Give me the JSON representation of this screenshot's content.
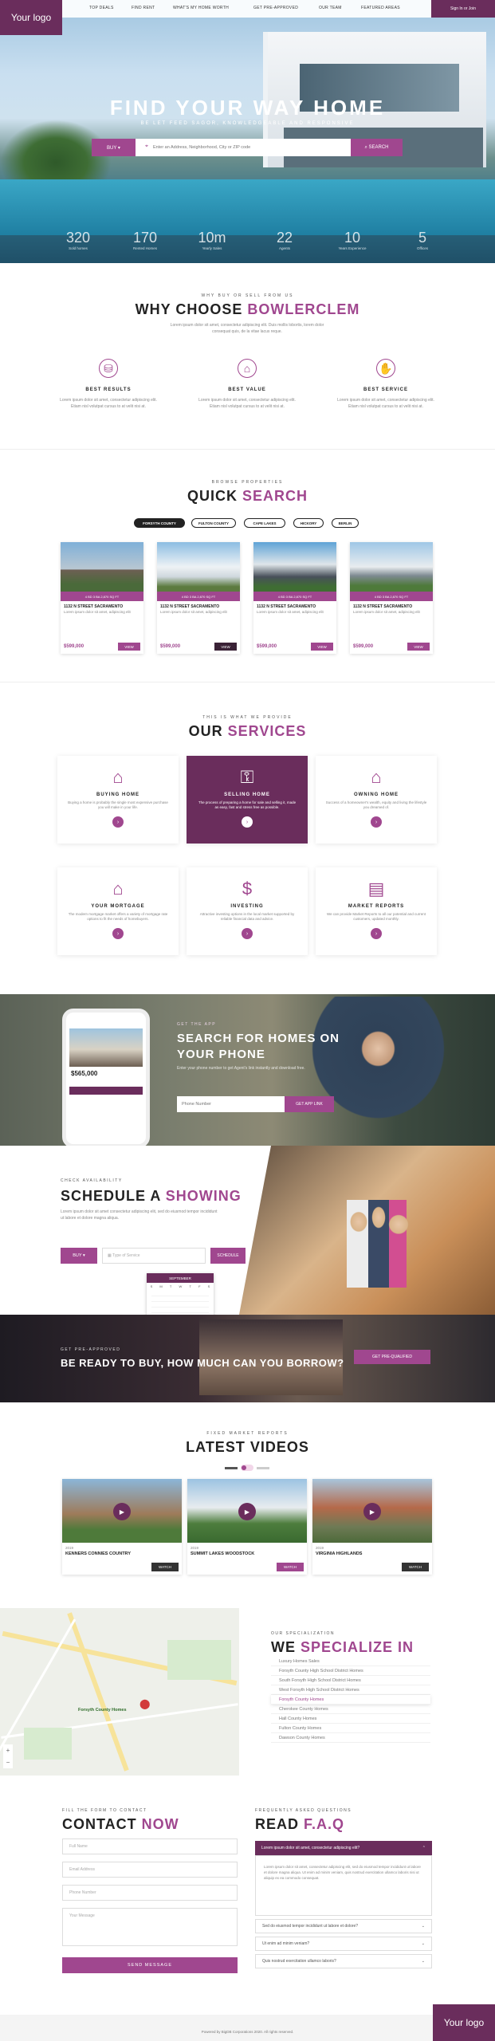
{
  "brand": {
    "logo": "Your logo",
    "accent": "#a0478f",
    "dark": "#6a2d5c"
  },
  "nav": {
    "items": [
      "Top Deals",
      "Find Rent",
      "What's My Home Worth",
      "Get Pre-Approved",
      "Our Team",
      "Featured Areas"
    ],
    "signin": "Sign In or Join"
  },
  "hero": {
    "title": "FIND YOUR WAY HOME",
    "subtitle": "BE LET FEED SAGOR, KNOWLEDGEABLE AND RESPONSIVE",
    "buy": "BUY ▾",
    "placeholder": "Enter an Address, Neighborhood, City or ZIP code",
    "search": "SEARCH",
    "stats": [
      {
        "n": "320",
        "l": "Sold homes"
      },
      {
        "n": "170",
        "l": "Rented Homes"
      },
      {
        "n": "10m",
        "l": "Yearly Sales"
      },
      {
        "n": "22",
        "l": "Agents"
      },
      {
        "n": "10",
        "l": "Years Experience"
      },
      {
        "n": "5",
        "l": "Offices"
      }
    ]
  },
  "why": {
    "kicker": "WHY BUY OR SELL FROM US",
    "title": "WHY CHOOSE",
    "title_acc": "BOWLERCLEM",
    "text": "Lorem ipsum dolor sit amet, consectetur adipiscing elit. Duis mollis lobortis, lorem dolor consequat quis, de la vitae lacus reque.",
    "items": [
      {
        "icon": "handshake-money-icon",
        "t": "BEST RESULTS",
        "d": "Lorem ipsum dolor sit amet, consectetur adipiscing elit. Etiam nisl volutpat cursus to at velit nisi at."
      },
      {
        "icon": "house-heart-icon",
        "t": "BEST VALUE",
        "d": "Lorem ipsum dolor sit amet, consectetur adipiscing elit. Etiam nisl volutpat cursus to at velit nisi at."
      },
      {
        "icon": "handshake-icon",
        "t": "BEST SERVICE",
        "d": "Lorem ipsum dolor sit amet, consectetur adipiscing elit. Etiam nisl volutpat cursus to at velit nisi at."
      }
    ]
  },
  "quick": {
    "kicker": "BROWSE PROPERTIES",
    "title": "QUICK",
    "title_acc": "SEARCH",
    "tabs": [
      "FORSYTH COUNTY",
      "FULTON COUNTY",
      "CAPE LAKES",
      "HICKORY",
      "BERLIN"
    ],
    "cards": [
      {
        "bar": "4 BD   3 BA   2,870 SQ FT",
        "addr": "1132 N STREET SACRAMENTO",
        "desc": "Lorem ipsum dolor sit amet, adipiscing elit",
        "price": "$599,000",
        "view": "VIEW"
      },
      {
        "bar": "4 BD   3 BA   2,870 SQ FT",
        "addr": "1132 N STREET SACRAMENTO",
        "desc": "Lorem ipsum dolor sit amet, adipiscing elit",
        "price": "$599,000",
        "view": "VIEW"
      },
      {
        "bar": "4 BD   3 BA   2,870 SQ FT",
        "addr": "1132 N STREET SACRAMENTO",
        "desc": "Lorem ipsum dolor sit amet, adipiscing elit",
        "price": "$599,000",
        "view": "VIEW"
      },
      {
        "bar": "4 BD   3 BA   2,870 SQ FT",
        "addr": "1132 N STREET SACRAMENTO",
        "desc": "Lorem ipsum dolor sit amet, adipiscing elit",
        "price": "$599,000",
        "view": "VIEW"
      }
    ]
  },
  "services": {
    "kicker": "THIS IS WHAT WE PROVIDE",
    "title": "OUR",
    "title_acc": "SERVICES",
    "items": [
      {
        "icon": "money-house-icon",
        "t": "BUYING HOME",
        "d": "Buying a home is probably the single most expensive purchase you will make in your life."
      },
      {
        "icon": "key-house-icon",
        "t": "SELLING HOME",
        "d": "The process of preparing a home for sale and selling it, made as easy, fast and stress free as possible."
      },
      {
        "icon": "house-hands-icon",
        "t": "OWNING HOME",
        "d": "Success of a homeowner's wealth, equity and living the lifestyle you dreamed of."
      },
      {
        "icon": "mortgage-house-icon",
        "t": "YOUR MORTGAGE",
        "d": "The modern mortgage market offers a variety of mortgage rate options to fit the needs of homebuyers."
      },
      {
        "icon": "investing-icon",
        "t": "INVESTING",
        "d": "Attractive investing options in the local market supported by reliable financial data and advice."
      },
      {
        "icon": "report-icon",
        "t": "MARKET REPORTS",
        "d": "We can provide Market Reports to all our potential and current customers, updated monthly."
      }
    ]
  },
  "app": {
    "kicker": "GET THE APP",
    "title1": "SEARCH FOR HOMES ON",
    "title2": "YOUR PHONE",
    "text": "Enter your phone number to get Agent's link instantly and download free.",
    "placeholder": "Phone Number",
    "btn": "GET APP LINK",
    "phone_price": "$565,000"
  },
  "schedule": {
    "kicker": "CHECK AVAILABILITY",
    "title": "SCHEDULE A",
    "title_acc": "SHOWING",
    "text": "Lorem ipsum dolor sit amet consectetur adipiscing elit, sed do eiusmod tempor incididunt ut labore et dolore magna aliqua.",
    "buy": "BUY ▾",
    "placeholder": "Type of Service",
    "btn": "SCHEDULE",
    "cal_title": "SEPTEMBER",
    "cal_days": [
      "S",
      "M",
      "T",
      "W",
      "T",
      "F",
      "S"
    ]
  },
  "preapp": {
    "kicker": "GET PRE-APPROVED",
    "title": "BE READY TO BUY, HOW MUCH CAN YOU BORROW?",
    "btn": "GET PRE-QUALIFIED"
  },
  "videos": {
    "kicker": "FIXED MARKET REPORTS",
    "title": "LATEST VIDEOS",
    "items": [
      {
        "date": "2019",
        "t": "KENNERS CONNIES COUNTRY",
        "btn": "WATCH"
      },
      {
        "date": "2019",
        "t": "SUMMIT LAKES WOODSTOCK",
        "btn": "WATCH"
      },
      {
        "date": "2019",
        "t": "VIRGINIA HIGHLANDS",
        "btn": "WATCH"
      }
    ]
  },
  "specialize": {
    "kicker": "OUR SPECIALIZATION",
    "title": "WE",
    "title_acc": "SPECIALIZE IN",
    "items": [
      "Luxury Homes Sales",
      "Forsyth County High School District Homes",
      "South Forsyth High School District Homes",
      "West Forsyth High School District Homes",
      "Forsyth County Homes",
      "Cherokee County Homes",
      "Hall County Homes",
      "Fulton County Homes",
      "Dawson County Homes"
    ],
    "map_label": "Forsyth County Homes"
  },
  "contact": {
    "kicker": "FILL THE FORM TO CONTACT",
    "title": "CONTACT",
    "title_acc": "NOW",
    "fields": [
      "Full Name",
      "Email Address",
      "Phone Number",
      "Your Message"
    ],
    "btn": "SEND MESSAGE"
  },
  "faq": {
    "kicker": "FREQUENTLY ASKED QUESTIONS",
    "title": "READ",
    "title_acc": "F.A.Q",
    "open_q": "Lorem ipsum dolor sit amet, consectetur adipiscing elit?",
    "open_a": "Lorem ipsum dolor sit amet, consectetur adipiscing elit, sed do eiusmod tempor incididunt ut labore et dolore magna aliqua. Ut enim ad minim veniam, quis nostrud exercitation ullamco laboris nisi ut aliquip ex ea commodo consequat.",
    "closed": [
      "Sed do eiusmod tempor incididunt ut labore et dolore?",
      "Ut enim ad minim veniam?",
      "Quis nostrud exercitation ullamco laboris?"
    ]
  },
  "footer": {
    "text": "Powered by BigDB Corporations 2020. All rights reserved.",
    "logo": "Your logo"
  }
}
